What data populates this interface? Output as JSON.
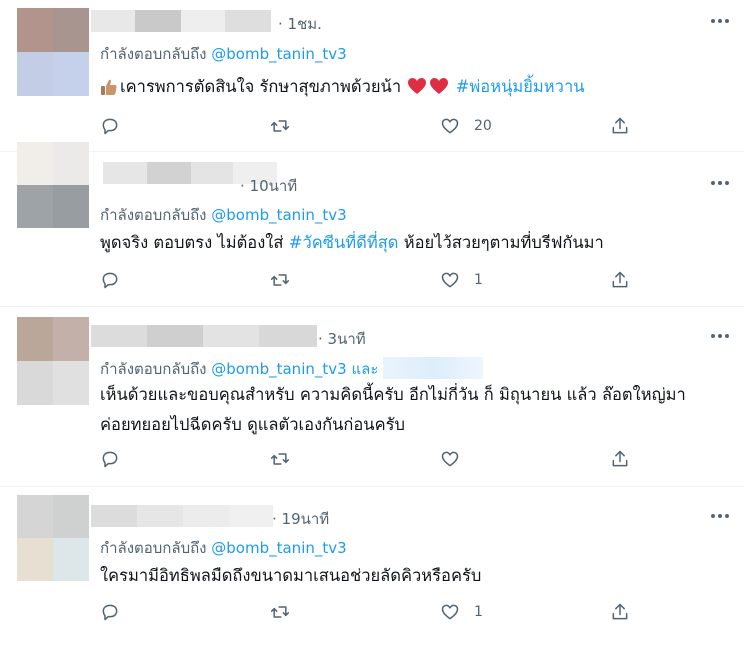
{
  "colors": {
    "link": "#1d9bf0",
    "secondary_text": "#536471",
    "primary_text": "#0f1419",
    "divider": "#eff3f4",
    "heart_emoji": "#dd2e44"
  },
  "tweets": [
    {
      "time": "· 1ชม.",
      "reply_prefix": "กำลังตอบกลับถึง",
      "reply_handle": "@bomb_tanin_tv3",
      "emoji": "thumbs-up",
      "text": "เคารพการตัดสินใจ รักษาสุขภาพด้วยน้า",
      "hearts": 2,
      "hashtag": "#พ่อหนุ่มยิ้มหวาน",
      "likes": "20",
      "avatar_colors": [
        "#b3948d",
        "#a8958f",
        "#c4cde6",
        "#c5d0ea"
      ],
      "name_blur_colors": [
        "#e8e8e8",
        "#c9c9c9",
        "#eeeeee",
        "#dedede"
      ]
    },
    {
      "time": "· 10นาที",
      "reply_prefix": "กำลังตอบกลับถึง",
      "reply_handle": "@bomb_tanin_tv3",
      "text_before": "พูดจริง ตอบตรง ไม่ต้องใส่ ",
      "hashtag": "#วัคซีนที่ดีที่สุด",
      "text_after": " ห้อยไว้สวยๆตามที่บรีฟกันมา",
      "likes": "1",
      "avatar_colors": [
        "#f1eeea",
        "#eceae8",
        "#9ea3a7",
        "#989da2"
      ],
      "name_blur_colors": [
        "#e6e6e6",
        "#d2d2d2",
        "#e4e4e4",
        "#efefef"
      ]
    },
    {
      "time": "· 3นาที",
      "reply_prefix": "กำลังตอบกลับถึง",
      "reply_handle": "@bomb_tanin_tv3",
      "reply_and": "และ",
      "text_line1": "เห็นด้วยและขอบคุณสำหรับ ความคิดนี้ครับ อีกไม่กี่วัน ก็ มิถุนายน แล้ว ล๊อตใหญ่มา",
      "text_line2": "ค่อยทยอยไปฉีดครับ  ดูแลตัวเองกันก่อนครับ",
      "likes": "",
      "avatar_colors": [
        "#bba69a",
        "#c3b0a8",
        "#d9d9d9",
        "#e0e0e0"
      ],
      "name_blur_colors": [
        "#dcdcdc",
        "#cfcfcf",
        "#e3e3e3",
        "#d8d8d8"
      ]
    },
    {
      "time": "· 19นาที",
      "reply_prefix": "กำลังตอบกลับถึง",
      "reply_handle": "@bomb_tanin_tv3",
      "text": "ใครมามีอิทธิพลมืดถึงขนาดมาเสนอช่วยลัดคิวหรือครับ",
      "likes": "1",
      "avatar_colors": [
        "#d5d5d5",
        "#cfd0d0",
        "#e7dfd2",
        "#dde6e8"
      ],
      "name_blur_colors": [
        "#dcdcdc",
        "#e6e6e6",
        "#ececec",
        "#f0f0f0"
      ]
    }
  ]
}
